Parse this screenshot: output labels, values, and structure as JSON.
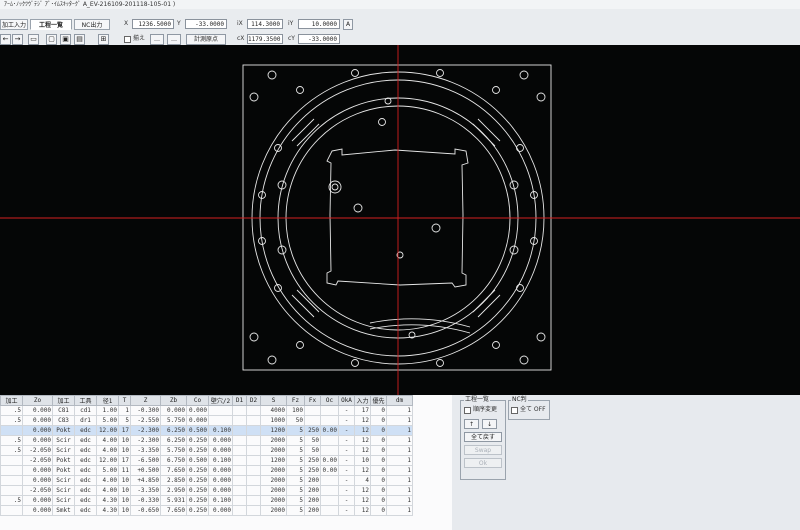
{
  "window": {
    "title": "ｱｰﾑ･ﾉｯｸﾂｳﾞﾃｼﾞ ｱﾞ･ｲﾑｽｷｯﾀｰｸﾞ A_EV-216109-201118-105-01 )"
  },
  "tabs": [
    {
      "label": "加工入力"
    },
    {
      "label": "工程一覧"
    },
    {
      "label": "NC出力"
    }
  ],
  "coords": {
    "x_label": "X",
    "x_value": "1236.5000",
    "y_label": "Y",
    "y_value": "-33.0000",
    "ix_label": "iX",
    "ix_value": "114.3000",
    "iy_label": "iY",
    "iy_value": "10.0000",
    "cx_label": "cX",
    "cx_value": "1179.3500",
    "cy_label": "cY",
    "cy_value": "-33.0000",
    "a_button": "A"
  },
  "toolbar": {
    "checkbox_label": "揃え",
    "btn1": "…",
    "btn2": "…",
    "calc_origin": "計測原点"
  },
  "table": {
    "headers": [
      "加工",
      "Zo",
      "加工",
      "工具",
      "径1",
      "T",
      "Z",
      "Zb",
      "Co",
      "壁穴/2",
      "D1",
      "D2",
      "S",
      "Fz",
      "Fx",
      "Oc",
      "OkA",
      "入力",
      "優先",
      "dm"
    ],
    "rows": [
      [
        ".5",
        "0.000",
        "C81",
        "cd1",
        "1.00",
        "1",
        "-0.300",
        "0.000",
        "0.000",
        "",
        "",
        "",
        "4000",
        "100",
        "",
        "",
        "-",
        "17",
        "0",
        "1"
      ],
      [
        ".5",
        "0.000",
        "C83",
        "dr1",
        "5.00",
        "5",
        "-2.550",
        "5.750",
        "0.000",
        "",
        "",
        "",
        "1000",
        "50",
        "",
        "",
        "-",
        "12",
        "0",
        "1"
      ],
      [
        "",
        "0.000",
        "Pokt",
        "edc",
        "12.00",
        "17",
        "-2.300",
        "6.250",
        "0.500",
        "0.100",
        "",
        "",
        "1200",
        "5",
        "250",
        "0.00",
        "-",
        "12",
        "0",
        "1"
      ],
      [
        ".5",
        "0.000",
        "Scir",
        "edc",
        "4.00",
        "10",
        "-2.300",
        "6.250",
        "0.250",
        "0.000",
        "",
        "",
        "2000",
        "5",
        "50",
        "",
        "-",
        "12",
        "0",
        "1"
      ],
      [
        ".5",
        "-2.050",
        "Scir",
        "edc",
        "4.00",
        "10",
        "-3.350",
        "5.750",
        "0.250",
        "0.000",
        "",
        "",
        "2000",
        "5",
        "50",
        "",
        "-",
        "12",
        "0",
        "1"
      ],
      [
        "",
        "-2.050",
        "Pokt",
        "edc",
        "12.00",
        "17",
        "-6.500",
        "6.750",
        "0.500",
        "0.100",
        "",
        "",
        "1200",
        "5",
        "250",
        "0.00",
        "-",
        "10",
        "0",
        "1"
      ],
      [
        "",
        "0.000",
        "Pokt",
        "edc",
        "5.00",
        "11",
        "+0.500",
        "7.650",
        "0.250",
        "0.000",
        "",
        "",
        "2000",
        "5",
        "250",
        "0.00",
        "-",
        "12",
        "0",
        "1"
      ],
      [
        "",
        "0.000",
        "Scir",
        "edc",
        "4.00",
        "10",
        "+4.850",
        "2.850",
        "0.250",
        "0.000",
        "",
        "",
        "2000",
        "5",
        "200",
        "",
        "-",
        "4",
        "0",
        "1"
      ],
      [
        "",
        "-2.050",
        "Scir",
        "edc",
        "4.00",
        "10",
        "-3.350",
        "2.950",
        "0.250",
        "0.000",
        "",
        "",
        "2000",
        "5",
        "200",
        "",
        "-",
        "12",
        "0",
        "1"
      ],
      [
        ".5",
        "0.000",
        "Scir",
        "edc",
        "4.30",
        "10",
        "-0.330",
        "5.931",
        "0.250",
        "0.100",
        "",
        "",
        "2000",
        "5",
        "200",
        "",
        "-",
        "12",
        "0",
        "1"
      ],
      [
        "",
        "0.000",
        "Smkt",
        "edc",
        "4.30",
        "10",
        "-0.650",
        "7.650",
        "0.250",
        "0.000",
        "",
        "",
        "2000",
        "5",
        "200",
        "",
        "-",
        "12",
        "0",
        "1"
      ]
    ]
  },
  "panel": {
    "group1_title": "工程一覧",
    "order_change": "順序変更",
    "group2_title": "NC判",
    "all_off": "全て OFF",
    "btn_up": "↑",
    "btn_down": "↓",
    "btn_return_all": "全て戻す",
    "btn_disabled1": "Swap",
    "btn_disabled2": "Ok"
  },
  "colors": {
    "canvas_bg": "#050606",
    "geometry": "#e8e8e8",
    "cursor": "#e02020",
    "panel_bg": "#e7eaee"
  }
}
